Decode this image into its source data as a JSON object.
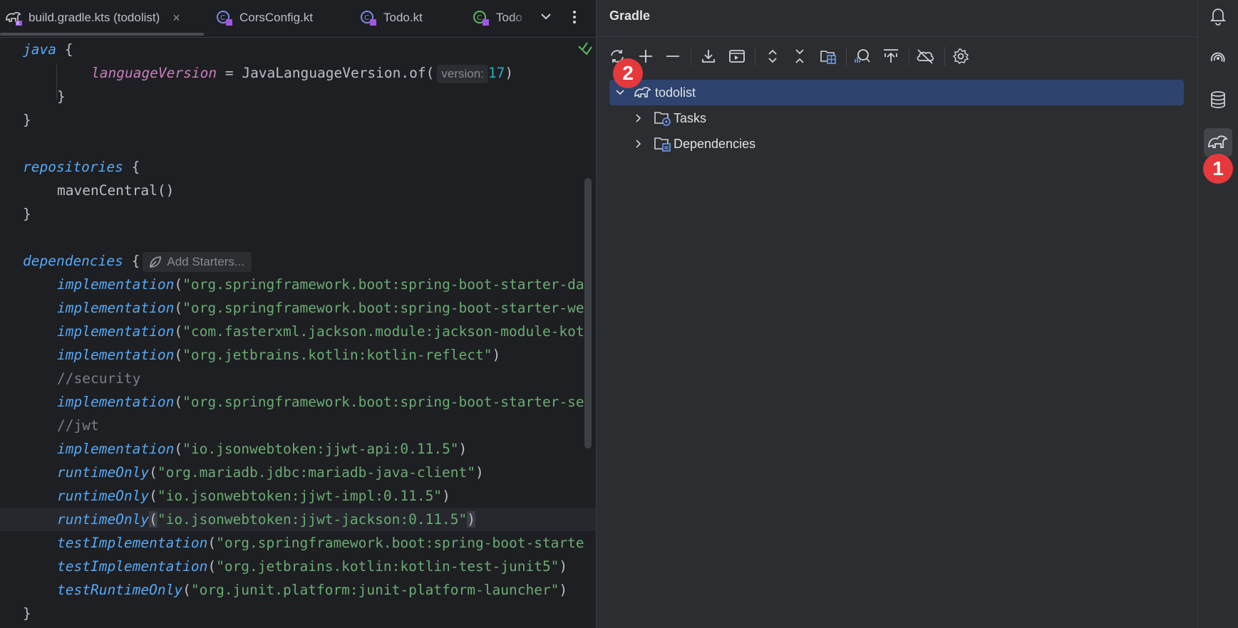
{
  "tabs": [
    {
      "label": "build.gradle.kts (todolist)",
      "icon": "gradle-kts-icon",
      "active": true
    },
    {
      "label": "CorsConfig.kt",
      "icon": "kotlin-class-icon"
    },
    {
      "label": "Todo.kt",
      "icon": "kotlin-class-icon"
    },
    {
      "label": "Todo",
      "icon": "kotlin-test-icon"
    }
  ],
  "tab_close_glyph": "×",
  "code": {
    "l1_kw": "java",
    "l1_rest": " {",
    "l2_prop": "languageVersion",
    "l2_mid": " = JavaLanguageVersion.of(",
    "l2_hint": "version:",
    "l2_num": "17",
    "l2_end": ")",
    "l3": "}",
    "l4": "}",
    "l6_kw": "repositories",
    "l6_rest": " {",
    "l7": "mavenCentral()",
    "l8": "}",
    "l10_kw": "dependencies",
    "l10_rest": " {",
    "l10_hint": "Add Starters...",
    "deps": [
      {
        "fn": "implementation",
        "open": "(",
        "str": "\"org.springframework.boot:spring-boot-starter-da",
        "close": ""
      },
      {
        "fn": "implementation",
        "open": "(",
        "str": "\"org.springframework.boot:spring-boot-starter-we",
        "close": ""
      },
      {
        "fn": "implementation",
        "open": "(",
        "str": "\"com.fasterxml.jackson.module:jackson-module-kot",
        "close": ""
      },
      {
        "fn": "implementation",
        "open": "(",
        "str": "\"org.jetbrains.kotlin:kotlin-reflect\"",
        "close": ")"
      }
    ],
    "c_security": "//security",
    "dep_security": {
      "fn": "implementation",
      "open": "(",
      "str": "\"org.springframework.boot:spring-boot-starter-se",
      "close": ""
    },
    "c_jwt": "//jwt",
    "deps2": [
      {
        "fn": "implementation",
        "open": "(",
        "str": "\"io.jsonwebtoken:jjwt-api:0.11.5\"",
        "close": ")"
      },
      {
        "fn": "runtimeOnly",
        "open": "(",
        "str": "\"org.mariadb.jdbc:mariadb-java-client\"",
        "close": ")"
      },
      {
        "fn": "runtimeOnly",
        "open": "(",
        "str": "\"io.jsonwebtoken:jjwt-impl:0.11.5\"",
        "close": ")"
      },
      {
        "fn": "runtimeOnly",
        "open": "(",
        "str": "\"io.jsonwebtoken:jjwt-jackson:0.11.5\"",
        "close": ")"
      },
      {
        "fn": "testImplementation",
        "open": "(",
        "str": "\"org.springframework.boot:spring-boot-starte",
        "close": ""
      },
      {
        "fn": "testImplementation",
        "open": "(",
        "str": "\"org.jetbrains.kotlin:kotlin-test-junit5\"",
        "close": ")"
      },
      {
        "fn": "testRuntimeOnly",
        "open": "(",
        "str": "\"org.junit.platform:junit-platform-launcher\"",
        "close": ")"
      }
    ],
    "last": "}"
  },
  "gradle": {
    "title": "Gradle",
    "toolbar": [
      "reload-icon",
      "add-icon",
      "remove-icon",
      "download-icon",
      "execute-task-icon",
      "expand-all-icon",
      "collapse-all-icon",
      "module-icon",
      "analyze-icon",
      "toggle-offline-icon",
      "cloud-off-icon",
      "settings-icon"
    ],
    "tree": {
      "root": "todolist",
      "children": [
        "Tasks",
        "Dependencies"
      ]
    }
  },
  "strip_icons": [
    "notifications-icon",
    "ai-assistant-icon",
    "database-icon",
    "gradle-icon"
  ],
  "badges": {
    "one": "1",
    "two": "2"
  },
  "colors": {
    "accent": "#2e436e",
    "badge": "#e5393b",
    "string": "#6aab73",
    "keyword": "#56a8f5"
  }
}
